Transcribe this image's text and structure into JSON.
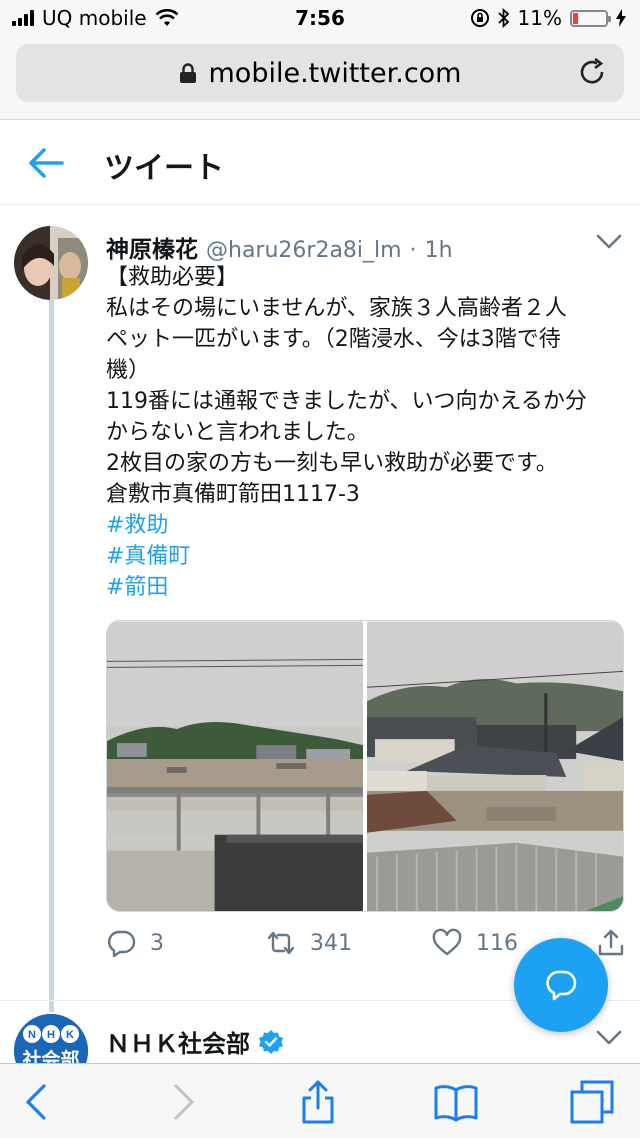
{
  "status_bar": {
    "carrier": "UQ mobile",
    "time": "7:56",
    "battery": "11%",
    "battery_level": 0.11
  },
  "browser": {
    "url": "mobile.twitter.com"
  },
  "header": {
    "title": "ツイート"
  },
  "tweet": {
    "name": "神原榛花",
    "handle": "@haru26r2a8i_lm",
    "separator": "·",
    "time": "1h",
    "lines": [
      "【救助必要】",
      "私はその場にいませんが、家族３人高齢者２人",
      "ペット一匹がいます。（2階浸水、今は3階で待",
      "機）",
      "119番には通報できましたが、いつ向かえるか分",
      "からないと言われました。",
      "2枚目の家の方も一刻も早い救助が必要です。",
      "倉敷市真備町箭田1117-3"
    ],
    "hashtags": [
      "#救助",
      "#真備町",
      "#箭田"
    ],
    "replies": "3",
    "retweets": "341",
    "likes": "116"
  },
  "next_tweet": {
    "name": "ＮＨＫ社会部",
    "avatar_text": "社会部"
  },
  "colors": {
    "accent": "#1da1f2",
    "muted": "#657786"
  },
  "icons": [
    "back-arrow-icon",
    "lock-icon",
    "reload-icon",
    "chevron-down-icon",
    "reply-icon",
    "retweet-icon",
    "like-icon",
    "share-icon",
    "compose-message-icon",
    "verified-icon",
    "safari-back-icon",
    "safari-forward-icon",
    "safari-share-icon",
    "bookmarks-icon",
    "tabs-icon"
  ]
}
